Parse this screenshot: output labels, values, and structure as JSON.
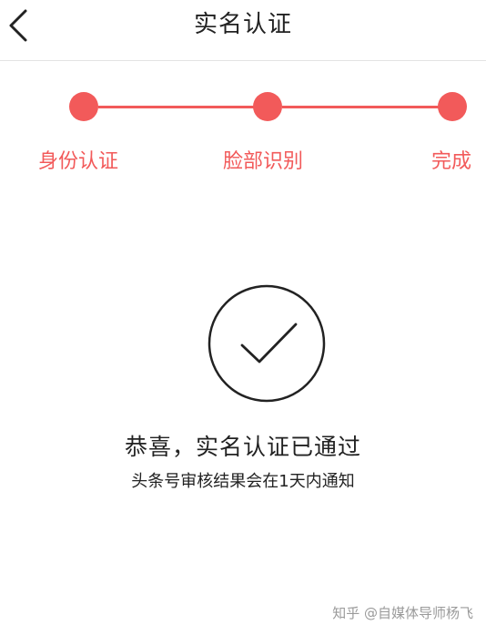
{
  "header": {
    "title": "实名认证",
    "back_icon": "chevron-left-icon"
  },
  "steps": {
    "accent_color": "#f25a5a",
    "items": [
      {
        "label": "身份认证"
      },
      {
        "label": "脸部识别"
      },
      {
        "label": "完成"
      }
    ],
    "current_step": 3
  },
  "result": {
    "icon": "checkmark-circle-icon",
    "title": "恭喜，实名认证已通过",
    "subtitle": "头条号审核结果会在1天内通知"
  },
  "watermark": {
    "text": "知乎 @自媒体导师杨飞"
  }
}
